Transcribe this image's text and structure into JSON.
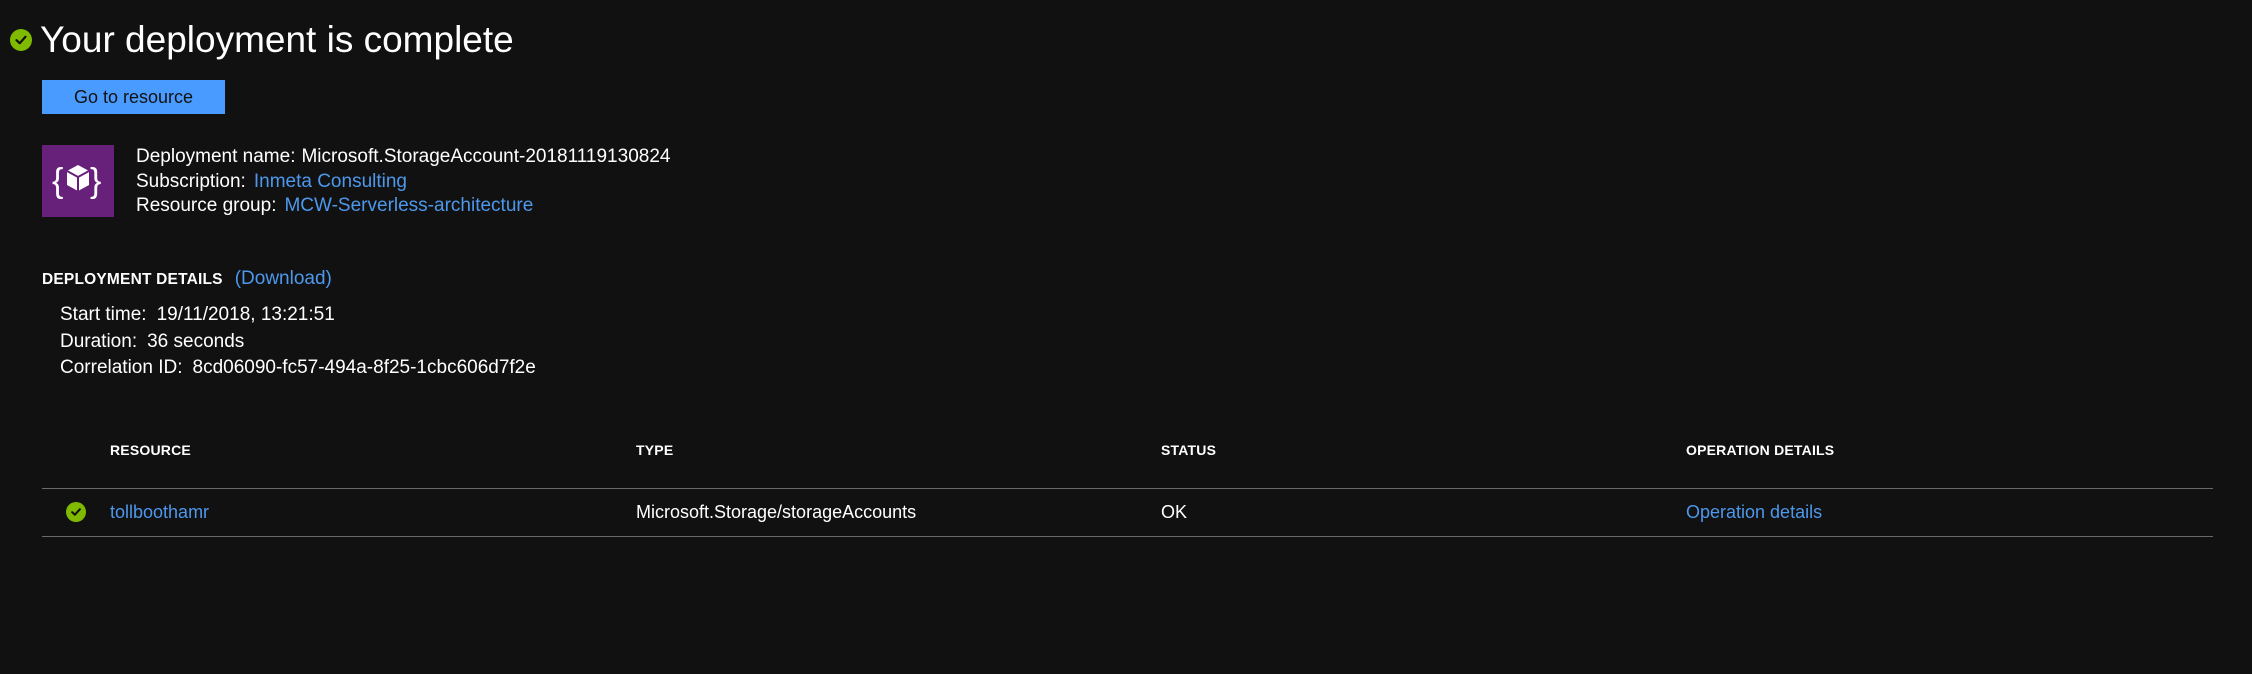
{
  "colors": {
    "background": "#111111",
    "accent_button": "#4a9bff",
    "link": "#4d98ec",
    "success": "#7fba00",
    "tile": "#68217a"
  },
  "header": {
    "status_icon": "success-check-icon",
    "title": "Your deployment is complete",
    "go_to_resource_label": "Go to resource"
  },
  "deployment": {
    "tile_icon": "resource-template-icon",
    "name_label": "Deployment name:",
    "name_value": "Microsoft.StorageAccount-20181119130824",
    "subscription_label": "Subscription:",
    "subscription_value": "Inmeta Consulting",
    "resource_group_label": "Resource group:",
    "resource_group_value": "MCW-Serverless-architecture"
  },
  "details": {
    "title": "DEPLOYMENT DETAILS",
    "download_label": "(Download)",
    "start_time_label": "Start time:",
    "start_time_value": "19/11/2018, 13:21:51",
    "duration_label": "Duration:",
    "duration_value": "36 seconds",
    "correlation_label": "Correlation ID:",
    "correlation_value": "8cd06090-fc57-494a-8f25-1cbc606d7f2e"
  },
  "table": {
    "columns": [
      "RESOURCE",
      "TYPE",
      "STATUS",
      "OPERATION DETAILS"
    ],
    "rows": [
      {
        "status_icon": "success-check-icon",
        "resource": "tollboothamr",
        "type": "Microsoft.Storage/storageAccounts",
        "status": "OK",
        "operation": "Operation details"
      }
    ]
  }
}
